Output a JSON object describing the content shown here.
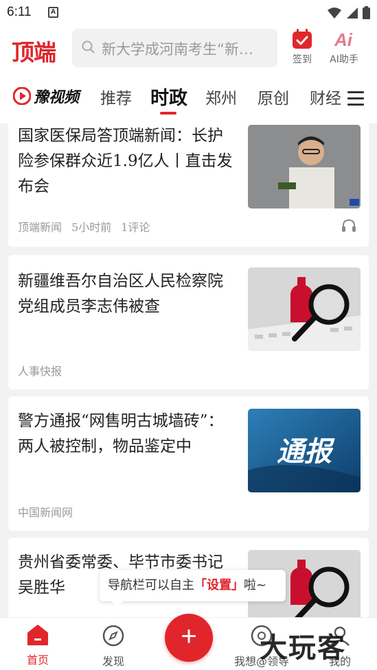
{
  "status": {
    "time": "6:11",
    "notif_glyph": "A"
  },
  "header": {
    "logo": "顶端",
    "search_placeholder": "新大学成河南考生“新…",
    "checkin_label": "签到",
    "ai_label": "AI助手"
  },
  "tabs": {
    "brand": "豫视频",
    "items": [
      {
        "label": "推荐"
      },
      {
        "label": "时政",
        "active": true
      },
      {
        "label": "郑州"
      },
      {
        "label": "原创"
      },
      {
        "label": "财经"
      }
    ]
  },
  "feed": [
    {
      "title": "国家医保局答顶端新闻：长护险参保群众近1.9亿人丨直击发布会",
      "source": "顶端新闻",
      "time": "5小时前",
      "comments": "1评论",
      "has_audio": true,
      "thumb": "speaker-photo"
    },
    {
      "title": " 新疆维吾尔自治区人民检察院党组成员李志伟被查",
      "source": "人事快报",
      "thumb": "magnifier-photo"
    },
    {
      "title": "警方通报“网售明古城墙砖”：两人被控制，物品鉴定中",
      "source": "中国新闻网",
      "thumb": "notice-banner",
      "thumb_text": "通报"
    },
    {
      "title": "贵州省委常委、毕节市委书记吴胜华",
      "thumb": "magnifier-photo"
    }
  ],
  "tooltip": {
    "before": "导航栏可以自主",
    "highlight": "「设置」",
    "after": "啦~"
  },
  "bottom_nav": {
    "home": "首页",
    "discover": "发现",
    "plus": "+",
    "mine_partial": "我想@领导",
    "me": "我的"
  },
  "watermark": "大玩客",
  "colors": {
    "accent": "#e0262b"
  }
}
